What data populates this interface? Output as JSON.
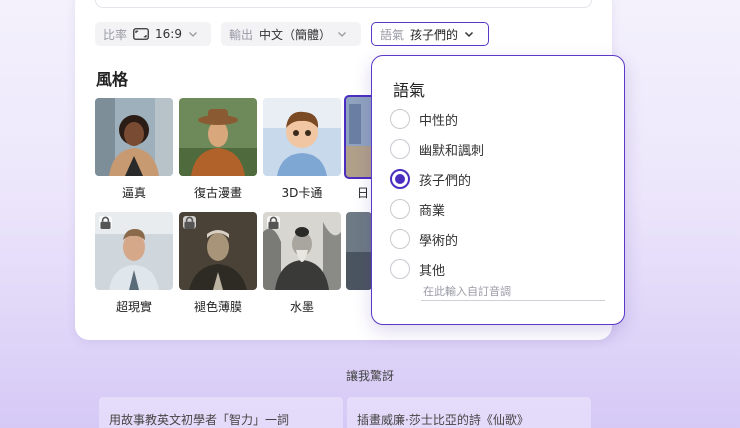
{
  "toolbar": {
    "ratio": {
      "key": "比率",
      "value": "16:9"
    },
    "output": {
      "key": "輸出",
      "value": "中文（簡體）"
    },
    "tone": {
      "key": "語氣",
      "value": "孩子們的"
    }
  },
  "style_section": {
    "title": "風格",
    "row1": [
      {
        "label": "逼真",
        "locked": false
      },
      {
        "label": "復古漫畫",
        "locked": false
      },
      {
        "label": "3D卡通",
        "locked": false
      },
      {
        "label": "日",
        "locked": false,
        "selected": true
      }
    ],
    "row2": [
      {
        "label": "超現實",
        "locked": true
      },
      {
        "label": "褪色薄膜",
        "locked": true
      },
      {
        "label": "水墨",
        "locked": true
      },
      {
        "label": "",
        "locked": true
      }
    ]
  },
  "tone_popover": {
    "title": "語氣",
    "options": [
      {
        "label": "中性的",
        "selected": false
      },
      {
        "label": "幽默和諷刺",
        "selected": false
      },
      {
        "label": "孩子們的",
        "selected": true
      },
      {
        "label": "商業",
        "selected": false
      },
      {
        "label": "學術的",
        "selected": false
      },
      {
        "label": "其他",
        "selected": false
      }
    ],
    "custom_placeholder": "在此輸入自訂音調"
  },
  "surprise_label": "讓我驚訝",
  "suggestions": [
    "用故事教英文初學者「智力」一詞",
    "插畫威廉·莎士比亞的詩《仙歌》"
  ],
  "colors": {
    "accent": "#4b2ec0",
    "popover_border": "#5a38c8"
  }
}
